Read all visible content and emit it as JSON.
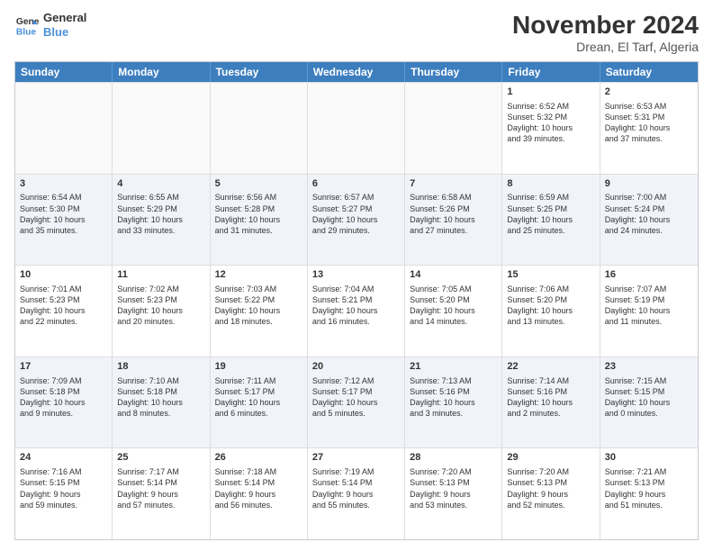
{
  "logo": {
    "line1": "General",
    "line2": "Blue"
  },
  "title": "November 2024",
  "location": "Drean, El Tarf, Algeria",
  "weekdays": [
    "Sunday",
    "Monday",
    "Tuesday",
    "Wednesday",
    "Thursday",
    "Friday",
    "Saturday"
  ],
  "rows": [
    {
      "alt": false,
      "cells": [
        {
          "day": "",
          "content": ""
        },
        {
          "day": "",
          "content": ""
        },
        {
          "day": "",
          "content": ""
        },
        {
          "day": "",
          "content": ""
        },
        {
          "day": "",
          "content": ""
        },
        {
          "day": "1",
          "content": "Sunrise: 6:52 AM\nSunset: 5:32 PM\nDaylight: 10 hours\nand 39 minutes."
        },
        {
          "day": "2",
          "content": "Sunrise: 6:53 AM\nSunset: 5:31 PM\nDaylight: 10 hours\nand 37 minutes."
        }
      ]
    },
    {
      "alt": true,
      "cells": [
        {
          "day": "3",
          "content": "Sunrise: 6:54 AM\nSunset: 5:30 PM\nDaylight: 10 hours\nand 35 minutes."
        },
        {
          "day": "4",
          "content": "Sunrise: 6:55 AM\nSunset: 5:29 PM\nDaylight: 10 hours\nand 33 minutes."
        },
        {
          "day": "5",
          "content": "Sunrise: 6:56 AM\nSunset: 5:28 PM\nDaylight: 10 hours\nand 31 minutes."
        },
        {
          "day": "6",
          "content": "Sunrise: 6:57 AM\nSunset: 5:27 PM\nDaylight: 10 hours\nand 29 minutes."
        },
        {
          "day": "7",
          "content": "Sunrise: 6:58 AM\nSunset: 5:26 PM\nDaylight: 10 hours\nand 27 minutes."
        },
        {
          "day": "8",
          "content": "Sunrise: 6:59 AM\nSunset: 5:25 PM\nDaylight: 10 hours\nand 25 minutes."
        },
        {
          "day": "9",
          "content": "Sunrise: 7:00 AM\nSunset: 5:24 PM\nDaylight: 10 hours\nand 24 minutes."
        }
      ]
    },
    {
      "alt": false,
      "cells": [
        {
          "day": "10",
          "content": "Sunrise: 7:01 AM\nSunset: 5:23 PM\nDaylight: 10 hours\nand 22 minutes."
        },
        {
          "day": "11",
          "content": "Sunrise: 7:02 AM\nSunset: 5:23 PM\nDaylight: 10 hours\nand 20 minutes."
        },
        {
          "day": "12",
          "content": "Sunrise: 7:03 AM\nSunset: 5:22 PM\nDaylight: 10 hours\nand 18 minutes."
        },
        {
          "day": "13",
          "content": "Sunrise: 7:04 AM\nSunset: 5:21 PM\nDaylight: 10 hours\nand 16 minutes."
        },
        {
          "day": "14",
          "content": "Sunrise: 7:05 AM\nSunset: 5:20 PM\nDaylight: 10 hours\nand 14 minutes."
        },
        {
          "day": "15",
          "content": "Sunrise: 7:06 AM\nSunset: 5:20 PM\nDaylight: 10 hours\nand 13 minutes."
        },
        {
          "day": "16",
          "content": "Sunrise: 7:07 AM\nSunset: 5:19 PM\nDaylight: 10 hours\nand 11 minutes."
        }
      ]
    },
    {
      "alt": true,
      "cells": [
        {
          "day": "17",
          "content": "Sunrise: 7:09 AM\nSunset: 5:18 PM\nDaylight: 10 hours\nand 9 minutes."
        },
        {
          "day": "18",
          "content": "Sunrise: 7:10 AM\nSunset: 5:18 PM\nDaylight: 10 hours\nand 8 minutes."
        },
        {
          "day": "19",
          "content": "Sunrise: 7:11 AM\nSunset: 5:17 PM\nDaylight: 10 hours\nand 6 minutes."
        },
        {
          "day": "20",
          "content": "Sunrise: 7:12 AM\nSunset: 5:17 PM\nDaylight: 10 hours\nand 5 minutes."
        },
        {
          "day": "21",
          "content": "Sunrise: 7:13 AM\nSunset: 5:16 PM\nDaylight: 10 hours\nand 3 minutes."
        },
        {
          "day": "22",
          "content": "Sunrise: 7:14 AM\nSunset: 5:16 PM\nDaylight: 10 hours\nand 2 minutes."
        },
        {
          "day": "23",
          "content": "Sunrise: 7:15 AM\nSunset: 5:15 PM\nDaylight: 10 hours\nand 0 minutes."
        }
      ]
    },
    {
      "alt": false,
      "cells": [
        {
          "day": "24",
          "content": "Sunrise: 7:16 AM\nSunset: 5:15 PM\nDaylight: 9 hours\nand 59 minutes."
        },
        {
          "day": "25",
          "content": "Sunrise: 7:17 AM\nSunset: 5:14 PM\nDaylight: 9 hours\nand 57 minutes."
        },
        {
          "day": "26",
          "content": "Sunrise: 7:18 AM\nSunset: 5:14 PM\nDaylight: 9 hours\nand 56 minutes."
        },
        {
          "day": "27",
          "content": "Sunrise: 7:19 AM\nSunset: 5:14 PM\nDaylight: 9 hours\nand 55 minutes."
        },
        {
          "day": "28",
          "content": "Sunrise: 7:20 AM\nSunset: 5:13 PM\nDaylight: 9 hours\nand 53 minutes."
        },
        {
          "day": "29",
          "content": "Sunrise: 7:20 AM\nSunset: 5:13 PM\nDaylight: 9 hours\nand 52 minutes."
        },
        {
          "day": "30",
          "content": "Sunrise: 7:21 AM\nSunset: 5:13 PM\nDaylight: 9 hours\nand 51 minutes."
        }
      ]
    }
  ]
}
